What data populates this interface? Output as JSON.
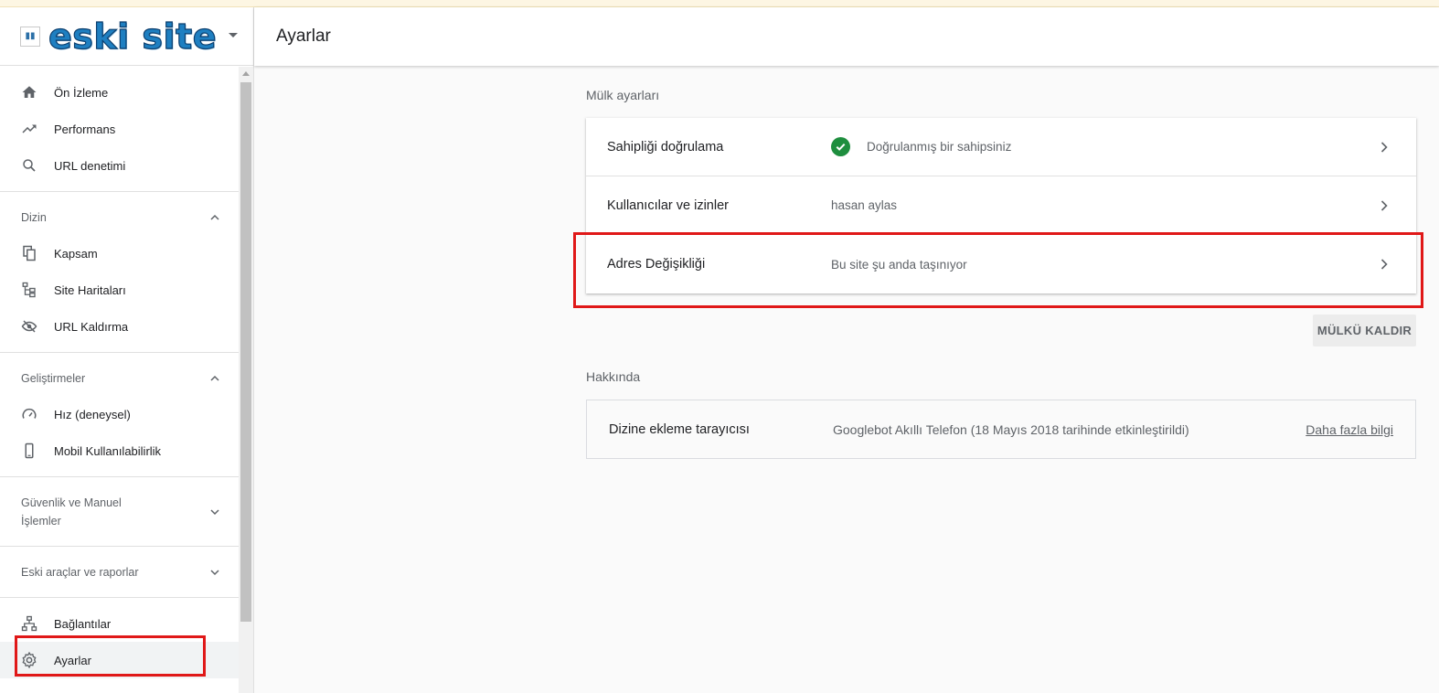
{
  "app": {
    "logo_text": "eski site",
    "favicon_glyph": "▮▮"
  },
  "sidebar": {
    "items_top": [
      {
        "label": "Ön İzleme",
        "icon": "home-icon"
      },
      {
        "label": "Performans",
        "icon": "trending-icon"
      },
      {
        "label": "URL denetimi",
        "icon": "search-icon"
      }
    ],
    "sections": [
      {
        "title": "Dizin",
        "expanded": true,
        "items": [
          {
            "label": "Kapsam",
            "icon": "coverage-icon"
          },
          {
            "label": "Site Haritaları",
            "icon": "sitemap-icon"
          },
          {
            "label": "URL Kaldırma",
            "icon": "eye-off-icon"
          }
        ]
      },
      {
        "title": "Geliştirmeler",
        "expanded": true,
        "items": [
          {
            "label": "Hız (deneysel)",
            "icon": "speed-icon"
          },
          {
            "label": "Mobil Kullanılabilirlik",
            "icon": "mobile-icon"
          }
        ]
      },
      {
        "title_line1": "Güvenlik ve Manuel",
        "title_line2": "İşlemler",
        "expanded": false
      },
      {
        "title": "Eski araçlar ve raporlar",
        "expanded": false
      }
    ],
    "items_bottom": [
      {
        "label": "Bağlantılar",
        "icon": "links-icon"
      },
      {
        "label": "Ayarlar",
        "icon": "gear-icon",
        "active": true
      }
    ]
  },
  "header": {
    "title": "Ayarlar"
  },
  "property_settings": {
    "title": "Mülk ayarları",
    "rows": [
      {
        "label": "Sahipliği doğrulama",
        "value": "Doğrulanmış bir sahipsiniz",
        "verified": true
      },
      {
        "label": "Kullanıcılar ve izinler",
        "value": "hasan aylas"
      },
      {
        "label": "Adres Değişikliği",
        "value": "Bu site şu anda taşınıyor"
      }
    ],
    "remove_button": "MÜLKÜ KALDIR"
  },
  "about": {
    "title": "Hakkında",
    "label": "Dizine ekleme tarayıcısı",
    "value": "Googlebot Akıllı Telefon (18 Mayıs 2018 tarihinde etkinleştirildi)",
    "link": "Daha fazla bilgi"
  },
  "colors": {
    "highlight": "#e01818",
    "verified_green": "#1e8e3e",
    "logo_blue": "#1e7fc1"
  }
}
